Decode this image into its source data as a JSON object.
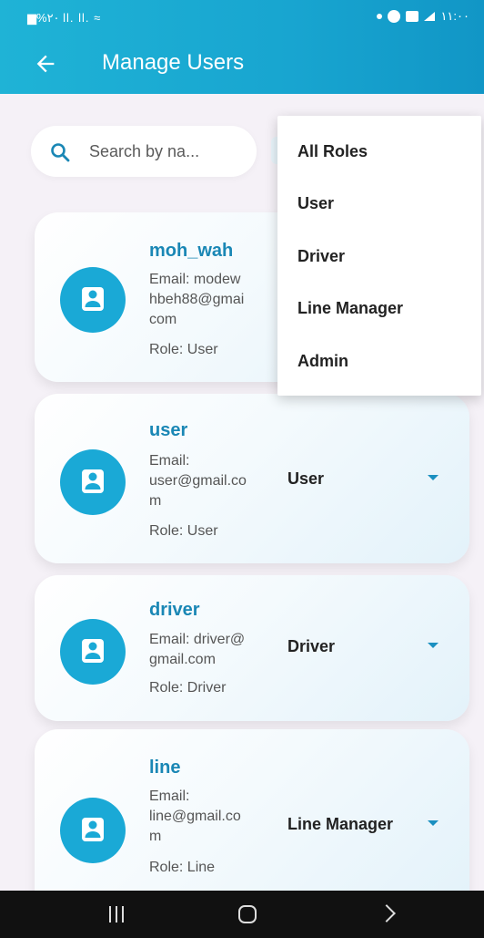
{
  "status": {
    "left_text": "▆%٢٠ ll. ll. ≈",
    "right_text": "١١:٠٠"
  },
  "header": {
    "title": "Manage Users"
  },
  "search": {
    "placeholder": "Search by na..."
  },
  "role_menu": {
    "items": [
      "All Roles",
      "User",
      "Driver",
      "Line Manager",
      "Admin"
    ]
  },
  "users": [
    {
      "name": "moh_wah",
      "email_lines": [
        "Email: modew",
        "hbeh88@gmai",
        "com"
      ],
      "role_text": "Role: User",
      "selected_role": ""
    },
    {
      "name": "user",
      "email_lines": [
        "Email:",
        "user@gmail.co",
        "m"
      ],
      "role_text": "Role: User",
      "selected_role": "User"
    },
    {
      "name": "driver",
      "email_lines": [
        "Email: driver@",
        "gmail.com"
      ],
      "role_text": "Role: Driver",
      "selected_role": "Driver"
    },
    {
      "name": "line",
      "email_lines": [
        "Email:",
        "line@gmail.co",
        "m"
      ],
      "role_text": "Role: Line",
      "selected_role": "Line Manager"
    }
  ],
  "colors": {
    "accent": "#1aa9d6",
    "name_text": "#1a87b5",
    "appbar": "#18a5d0"
  },
  "icons": {
    "back": "arrow-left-icon",
    "search": "search-icon",
    "avatar": "person-icon",
    "dropdown": "caret-down-icon"
  }
}
